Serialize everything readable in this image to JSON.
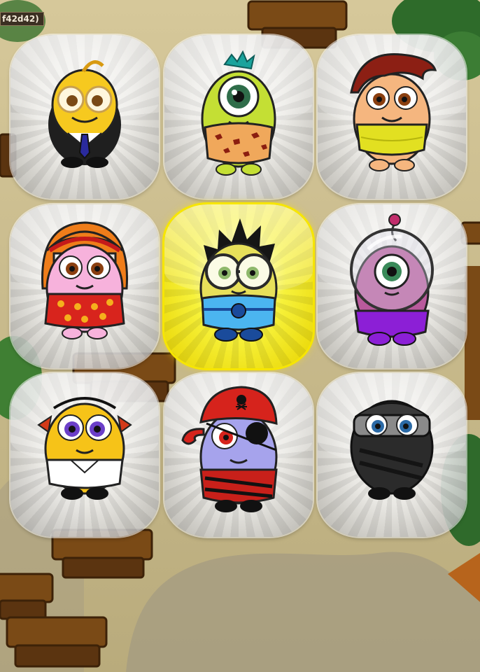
{
  "id_label": "f42d42)",
  "selected_index": 4,
  "characters": [
    {
      "icon": "businessman-character-icon",
      "selected": false
    },
    {
      "icon": "caveman-cyclops-character-icon",
      "selected": false
    },
    {
      "icon": "redhead-boy-character-icon",
      "selected": false
    },
    {
      "icon": "redhead-girl-character-icon",
      "selected": false
    },
    {
      "icon": "nerd-glasses-character-icon",
      "selected": true
    },
    {
      "icon": "alien-astronaut-character-icon",
      "selected": false
    },
    {
      "icon": "pigtail-girl-character-icon",
      "selected": false
    },
    {
      "icon": "pirate-character-icon",
      "selected": false
    },
    {
      "icon": "ninja-character-icon",
      "selected": false
    }
  ],
  "colors": {
    "selected_glow": "#f7e600",
    "card_base": "#e9e9e9",
    "background": "#c8b98a"
  }
}
